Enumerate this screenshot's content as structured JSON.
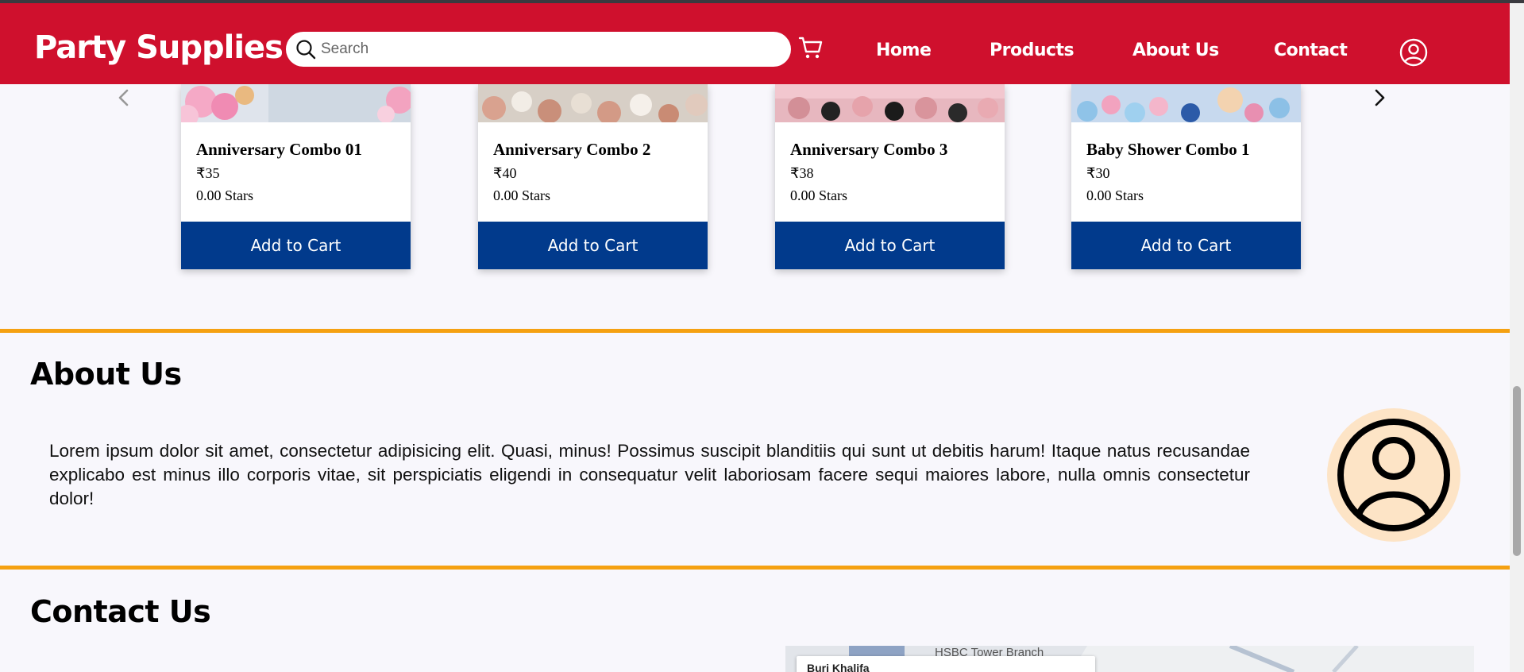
{
  "header": {
    "brand": "Party Supplies",
    "search_placeholder": "Search",
    "nav": [
      {
        "label": "Home"
      },
      {
        "label": "Products"
      },
      {
        "label": "About Us"
      },
      {
        "label": "Contact"
      }
    ]
  },
  "products": [
    {
      "name": "Anniversary Combo 01",
      "price": "₹35",
      "rating": "0.00 Stars",
      "button": "Add to Cart"
    },
    {
      "name": "Anniversary Combo 2",
      "price": "₹40",
      "rating": "0.00 Stars",
      "button": "Add to Cart"
    },
    {
      "name": "Anniversary Combo 3",
      "price": "₹38",
      "rating": "0.00 Stars",
      "button": "Add to Cart"
    },
    {
      "name": "Baby Shower Combo 1",
      "price": "₹30",
      "rating": "0.00 Stars",
      "button": "Add to Cart"
    }
  ],
  "about": {
    "title": "About Us",
    "text": "Lorem ipsum dolor sit amet, consectetur adipisicing elit. Quasi, minus! Possimus suscipit blanditiis qui sunt ut debitis harum! Itaque natus recusandae explicabo est minus illo corporis vitae, sit perspiciatis eligendi in consequatur velit laboriosam facere sequi maiores labore, nulla omnis consectetur dolor!"
  },
  "contact": {
    "title": "Contact Us",
    "map_label": "HSBC Tower Branch",
    "map_place": "Burj Khalifa"
  },
  "colors": {
    "header_bg": "#cf102d",
    "button_bg": "#013a8c",
    "divider": "#f5a112",
    "avatar_bg": "#fde4c6"
  },
  "icons": [
    "search-icon",
    "cart-icon",
    "user-icon",
    "chevron-left-icon",
    "chevron-right-icon",
    "user-avatar-icon"
  ]
}
